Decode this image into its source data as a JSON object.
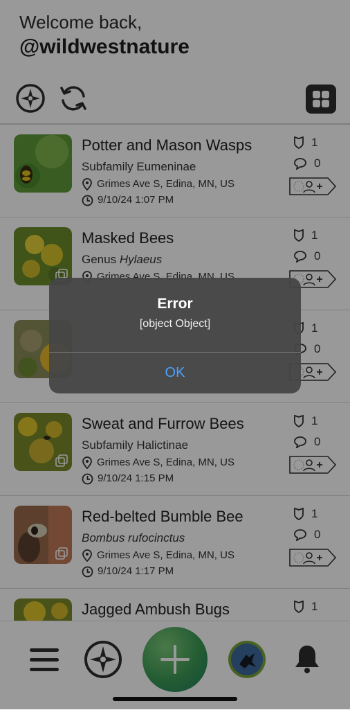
{
  "header": {
    "welcome": "Welcome back,",
    "username": "@wildwestnature"
  },
  "toolbar": {
    "explore_icon": "compass-icon",
    "sync_icon": "sync-icon",
    "grid_icon": "grid-icon"
  },
  "observations": [
    {
      "name": "Potter and Mason Wasps",
      "taxon": "Subfamily Eumeninae",
      "taxon_rank": "Subfamily",
      "taxon_name": "Eumeninae",
      "italic": false,
      "location": "Grimes Ave S, Edina, MN, US",
      "time": "9/10/24 1:07 PM",
      "ids": "1",
      "comments": "0",
      "multi_photo": false
    },
    {
      "name": "Masked Bees",
      "taxon": "Genus Hylaeus",
      "taxon_rank": "Genus",
      "taxon_name": "Hylaeus",
      "italic": true,
      "location": "Grimes Ave S, Edina, MN, US",
      "time": "",
      "ids": "1",
      "comments": "0",
      "multi_photo": true
    },
    {
      "name": "",
      "taxon": "",
      "taxon_rank": "",
      "taxon_name": "",
      "italic": false,
      "location": "",
      "time": "",
      "ids": "1",
      "comments": "0",
      "multi_photo": false
    },
    {
      "name": "Sweat and Furrow Bees",
      "taxon": "Subfamily Halictinae",
      "taxon_rank": "Subfamily",
      "taxon_name": "Halictinae",
      "italic": false,
      "location": "Grimes Ave S, Edina, MN, US",
      "time": "9/10/24 1:15 PM",
      "ids": "1",
      "comments": "0",
      "multi_photo": true
    },
    {
      "name": "Red-belted Bumble Bee",
      "taxon": "Bombus rufocinctus",
      "taxon_rank": "",
      "taxon_name": "Bombus rufocinctus",
      "italic": true,
      "location": "Grimes Ave S, Edina, MN, US",
      "time": "9/10/24 1:17 PM",
      "ids": "1",
      "comments": "0",
      "multi_photo": true
    },
    {
      "name": "Jagged Ambush Bugs",
      "taxon": "",
      "taxon_rank": "",
      "taxon_name": "",
      "italic": false,
      "location": "",
      "time": "",
      "ids": "1",
      "comments": "",
      "multi_photo": false
    }
  ],
  "bottom_nav": {
    "menu_icon": "hamburger-menu-icon",
    "explore_icon": "compass-icon",
    "add_icon": "plus-icon",
    "avatar_icon": "user-avatar",
    "bell_icon": "bell-icon"
  },
  "dialog": {
    "title": "Error",
    "message": "[object Object]",
    "ok_label": "OK"
  },
  "colors": {
    "accent": "#4aa3ff",
    "add_button": "#3c9a55",
    "overlay": "rgba(0,0,0,0.40)"
  }
}
